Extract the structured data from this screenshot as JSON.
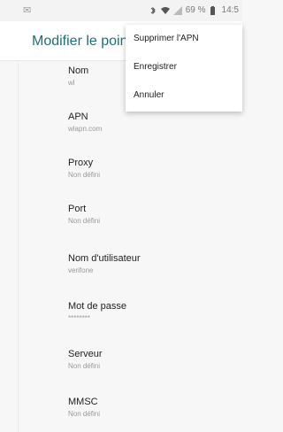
{
  "statusbar": {
    "icons": [
      "bluetooth-icon",
      "wifi-icon",
      "signal-icon",
      "battery-icon"
    ],
    "battery": "69 %",
    "time": "14:5"
  },
  "appbar": {
    "title": "Modifier le point"
  },
  "menu": [
    {
      "label": "Supprimer l'APN"
    },
    {
      "label": "Enregistrer"
    },
    {
      "label": "Annuler"
    }
  ],
  "fields": [
    {
      "title": "Nom",
      "value": "wl"
    },
    {
      "title": "APN",
      "value": "wlapn.com"
    },
    {
      "title": "Proxy",
      "value": "Non défini"
    },
    {
      "title": "Port",
      "value": "Non défini"
    },
    {
      "title": "Nom d'utilisateur",
      "value": "verifone"
    },
    {
      "title": "Mot de passe",
      "value": "********"
    },
    {
      "title": "Serveur",
      "value": "Non défini"
    },
    {
      "title": "MMSC",
      "value": "Non défini"
    }
  ],
  "colors": {
    "accent": "#1f6f73"
  }
}
